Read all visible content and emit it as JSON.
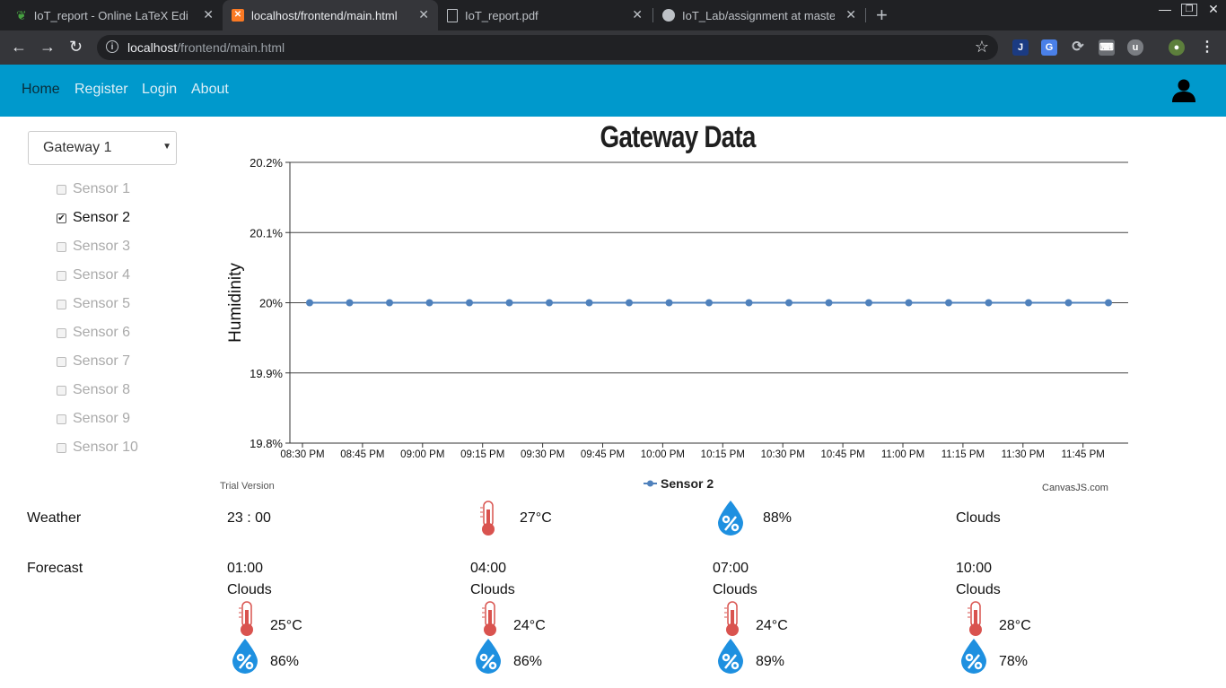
{
  "browser": {
    "tabs": [
      {
        "title": "IoT_report - Online LaTeX Editor",
        "icon": "overleaf-leaf-icon"
      },
      {
        "title": "localhost/frontend/main.html",
        "icon": "xampp-icon"
      },
      {
        "title": "IoT_report.pdf",
        "icon": "document-icon"
      },
      {
        "title": "IoT_Lab/assignment at master",
        "icon": "github-icon"
      }
    ],
    "url_host": "localhost",
    "url_path": "/frontend/main.html"
  },
  "nav": {
    "items": [
      "Home",
      "Register",
      "Login",
      "About"
    ],
    "active": "Home",
    "brand_color": "#0099cc"
  },
  "sidebar": {
    "gateway_selected": "Gateway 1",
    "sensors": [
      {
        "label": "Sensor 1",
        "checked": false
      },
      {
        "label": "Sensor 2",
        "checked": true
      },
      {
        "label": "Sensor 3",
        "checked": false
      },
      {
        "label": "Sensor 4",
        "checked": false
      },
      {
        "label": "Sensor 5",
        "checked": false
      },
      {
        "label": "Sensor 6",
        "checked": false
      },
      {
        "label": "Sensor 7",
        "checked": false
      },
      {
        "label": "Sensor 8",
        "checked": false
      },
      {
        "label": "Sensor 9",
        "checked": false
      },
      {
        "label": "Sensor 10",
        "checked": false
      }
    ]
  },
  "chart_data": {
    "type": "line",
    "title": "Gateway Data",
    "ylabel": "Humidinity",
    "xlabel": "",
    "yticks": [
      "20.2%",
      "20.1%",
      "20%",
      "19.9%",
      "19.8%"
    ],
    "ylim": [
      19.8,
      20.2
    ],
    "xticks": [
      "08:30 PM",
      "08:45 PM",
      "09:00 PM",
      "09:15 PM",
      "09:30 PM",
      "09:45 PM",
      "10:00 PM",
      "10:15 PM",
      "10:30 PM",
      "10:45 PM",
      "11:00 PM",
      "11:15 PM",
      "11:30 PM",
      "11:45 PM"
    ],
    "grid": true,
    "legend": "bottom-center",
    "series": [
      {
        "name": "Sensor 2",
        "color": "#4f81bc",
        "values": [
          20,
          20,
          20,
          20,
          20,
          20,
          20,
          20,
          20,
          20,
          20,
          20,
          20,
          20,
          20,
          20,
          20,
          20,
          20,
          20,
          20
        ]
      }
    ],
    "watermark_left": "Trial Version",
    "watermark_right": "CanvasJS.com"
  },
  "weather": {
    "label": "Weather",
    "time": "23 : 00",
    "temp": "27°C",
    "humidity": "88%",
    "condition": "Clouds"
  },
  "forecast": {
    "label": "Forecast",
    "items": [
      {
        "time": "01:00",
        "condition": "Clouds",
        "temp": "25°C",
        "humidity": "86%"
      },
      {
        "time": "04:00",
        "condition": "Clouds",
        "temp": "24°C",
        "humidity": "86%"
      },
      {
        "time": "07:00",
        "condition": "Clouds",
        "temp": "24°C",
        "humidity": "89%"
      },
      {
        "time": "10:00",
        "condition": "Clouds",
        "temp": "28°C",
        "humidity": "78%"
      }
    ]
  }
}
